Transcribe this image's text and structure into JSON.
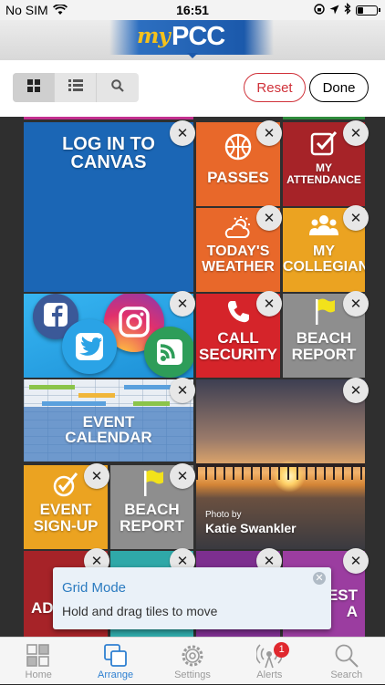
{
  "status_bar": {
    "carrier": "No SIM",
    "time": "16:51",
    "battery_level": 0.3
  },
  "logo": {
    "my": "my",
    "pcc": "PCC"
  },
  "toolbar": {
    "view_modes": [
      "grid-view-icon",
      "list-view-icon",
      "search-icon"
    ],
    "reset_label": "Reset",
    "done_label": "Done"
  },
  "tiles": {
    "canvas": {
      "line1": "LOG IN TO",
      "line2": "CANVAS"
    },
    "passes": {
      "label": "PASSES"
    },
    "attendance": {
      "line1": "MY",
      "line2": "ATTENDANCE"
    },
    "weather": {
      "line1": "TODAY'S",
      "line2": "WEATHER"
    },
    "collegian": {
      "line1": "MY",
      "line2": "COLLEGIAN"
    },
    "security": {
      "line1": "CALL",
      "line2": "SECURITY"
    },
    "beach_report_1": {
      "line1": "BEACH",
      "line2": "REPORT"
    },
    "event_calendar": {
      "line1": "EVENT",
      "line2": "CALENDAR"
    },
    "photo": {
      "credit_line1": "Photo by",
      "credit_line2": "Katie Swankler"
    },
    "event_signup": {
      "line1": "EVENT",
      "line2": "SIGN-UP"
    },
    "beach_report_2": {
      "line1": "BEACH",
      "line2": "REPORT"
    },
    "partial_left": {
      "label": "AD"
    },
    "partial_right": {
      "line1": "EST",
      "line2": "A"
    }
  },
  "tooltip": {
    "title": "Grid Mode",
    "body": "Hold and drag tiles to move"
  },
  "tabs": [
    {
      "label": "Home",
      "icon": "home-grid-icon",
      "active": false
    },
    {
      "label": "Arrange",
      "icon": "arrange-icon",
      "active": true
    },
    {
      "label": "Settings",
      "icon": "gear-icon",
      "active": false
    },
    {
      "label": "Alerts",
      "icon": "broadcast-icon",
      "active": false,
      "badge": "1"
    },
    {
      "label": "Search",
      "icon": "search-icon",
      "active": false
    }
  ],
  "colors": {
    "canvas_blue": "#1b66b5",
    "orange": "#e8682a",
    "dark_red": "#a62328",
    "gold": "#eba321",
    "red": "#d5242a",
    "gray": "#8e8e8e",
    "accent_blue": "#2f80d1"
  }
}
